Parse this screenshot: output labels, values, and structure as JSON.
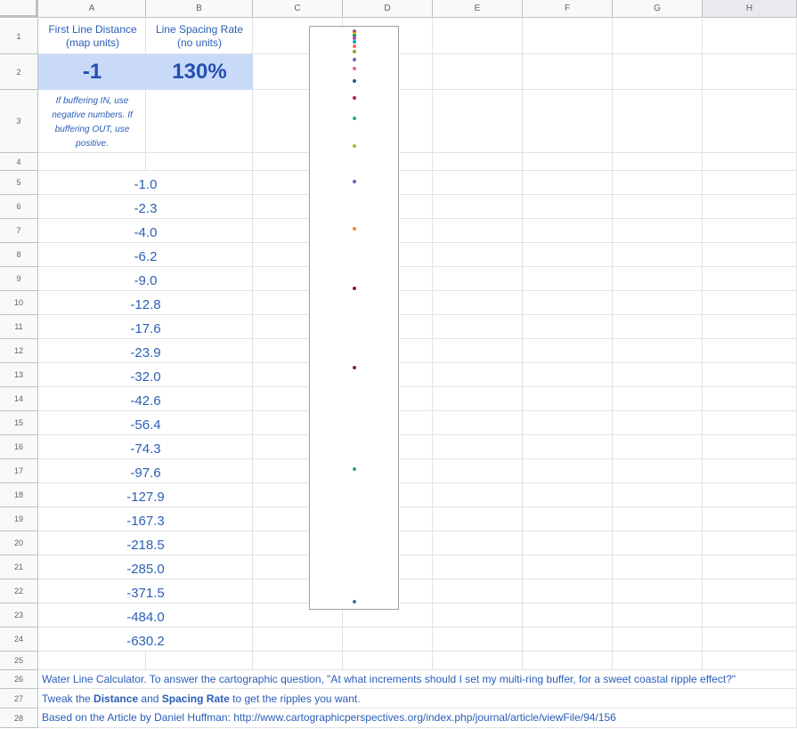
{
  "columns": [
    "A",
    "B",
    "C",
    "D",
    "E",
    "F",
    "G",
    "H"
  ],
  "rows": [
    "1",
    "2",
    "3",
    "4",
    "5",
    "6",
    "7",
    "8",
    "9",
    "10",
    "11",
    "12",
    "13",
    "14",
    "15",
    "16",
    "17",
    "18",
    "19",
    "20",
    "21",
    "22",
    "23",
    "24",
    "25",
    "26",
    "27",
    "28"
  ],
  "header": {
    "a1": "First Line Distance (map units)",
    "b1": "Line Spacing Rate (no units)"
  },
  "inputs": {
    "distance": "-1",
    "rate": "130%"
  },
  "note": "If buffering IN, use negative numbers. If buffering OUT, use positive.",
  "values": [
    "-1.0",
    "-2.3",
    "-4.0",
    "-6.2",
    "-9.0",
    "-12.8",
    "-17.6",
    "-23.9",
    "-32.0",
    "-42.6",
    "-56.4",
    "-74.3",
    "-97.6",
    "-127.9",
    "-167.3",
    "-218.5",
    "-285.0",
    "-371.5",
    "-484.0",
    "-630.2"
  ],
  "footer": {
    "line1": "Water Line Calculator. To answer the cartographic question, \"At what increments should I set my multi-ring buffer, for a sweet coastal ripple effect?\"",
    "line2_pre": "Tweak the ",
    "line2_b1": "Distance",
    "line2_mid": " and ",
    "line2_b2": "Spacing Rate",
    "line2_post": " to get the ripples you want.",
    "line3": "Based on the Article by Daniel Huffman: http://www.cartographicperspectives.org/index.php/journal/article/viewFile/94/156"
  },
  "chart_data": {
    "type": "scatter",
    "title": "",
    "xlabel": "",
    "ylabel": "",
    "ylim": [
      -632,
      0
    ],
    "x": [
      1,
      1,
      1,
      1,
      1,
      1,
      1,
      1,
      1,
      1,
      1,
      1,
      1,
      1,
      1,
      1,
      1,
      1,
      1,
      1
    ],
    "y": [
      -1.0,
      -2.3,
      -4.0,
      -6.2,
      -9.0,
      -12.8,
      -17.6,
      -23.9,
      -32.0,
      -42.6,
      -56.4,
      -74.3,
      -97.6,
      -127.9,
      -167.3,
      -218.5,
      -285.0,
      -371.5,
      -484.0,
      -630.2
    ],
    "colors": [
      "#4285f4",
      "#db4437",
      "#f4b400",
      "#0f9d58",
      "#ab47bc",
      "#00acc1",
      "#ff7043",
      "#9e9d24",
      "#5c6bc0",
      "#f06292",
      "#1e5a96",
      "#c2185b",
      "#26a69a",
      "#afb42b",
      "#7e57c2",
      "#ef8f1c",
      "#8b1a1a",
      "#7b1f5e",
      "#3f9f7f",
      "#4a6fa5"
    ]
  }
}
